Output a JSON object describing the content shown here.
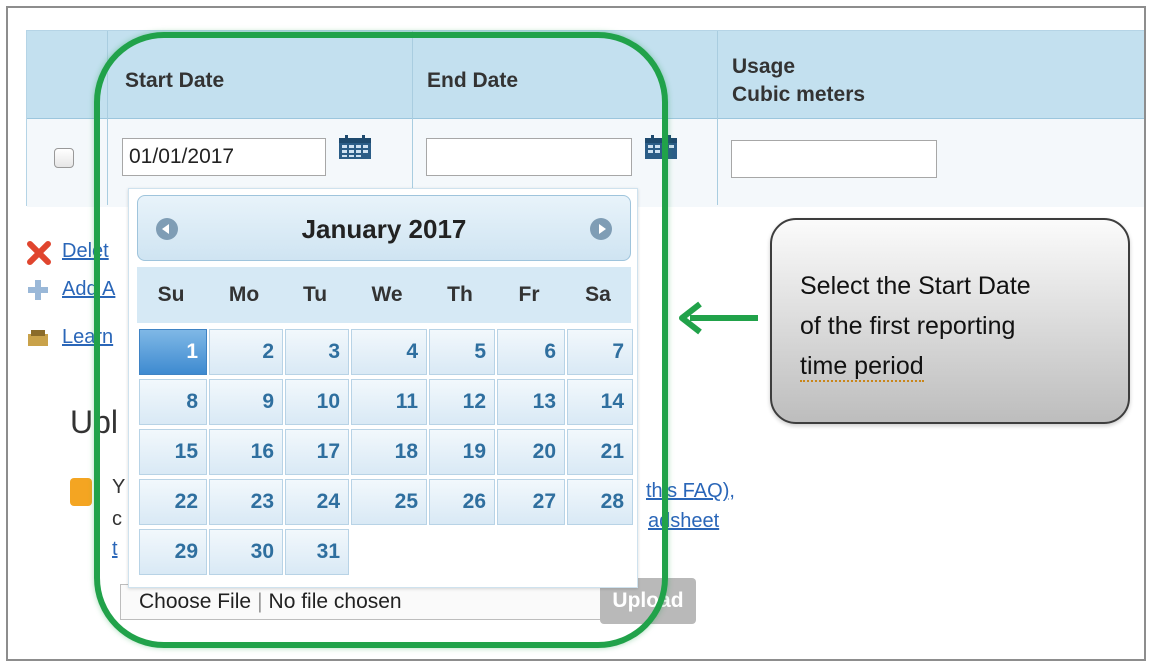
{
  "table": {
    "headers": {
      "start_date": "Start Date",
      "end_date": "End Date",
      "usage_line1": "Usage",
      "usage_line2": "Cubic meters"
    },
    "start_date_value": "01/01/2017",
    "end_date_value": "",
    "usage_value": ""
  },
  "links": {
    "delete_fragment": "Delet",
    "add_fragment": "Add A",
    "learn_fragment": "Learn"
  },
  "upload": {
    "title_fragment": "Upl",
    "note_fragment_1": "this FAQ),",
    "note_fragment_2": "adsheet",
    "note_left_1": "Y",
    "note_left_2": "c",
    "note_left_3": "t",
    "choose_file_label": "Choose File",
    "no_file_text": "No file chosen",
    "upload_button": "Upload"
  },
  "datepicker": {
    "month_title": "January 2017",
    "weekdays": [
      "Su",
      "Mo",
      "Tu",
      "We",
      "Th",
      "Fr",
      "Sa"
    ],
    "days": [
      "1",
      "2",
      "3",
      "4",
      "5",
      "6",
      "7",
      "8",
      "9",
      "10",
      "11",
      "12",
      "13",
      "14",
      "15",
      "16",
      "17",
      "18",
      "19",
      "20",
      "21",
      "22",
      "23",
      "24",
      "25",
      "26",
      "27",
      "28",
      "29",
      "30",
      "31"
    ],
    "selected_day": "1"
  },
  "callout": {
    "line1": "Select the Start Date",
    "line2": "of the first reporting",
    "line3": "time period"
  },
  "colors": {
    "annotation_green": "#21a24a",
    "header_blue": "#c3e0ef",
    "link_blue": "#2a66b8",
    "day_text": "#2f6f9f"
  }
}
